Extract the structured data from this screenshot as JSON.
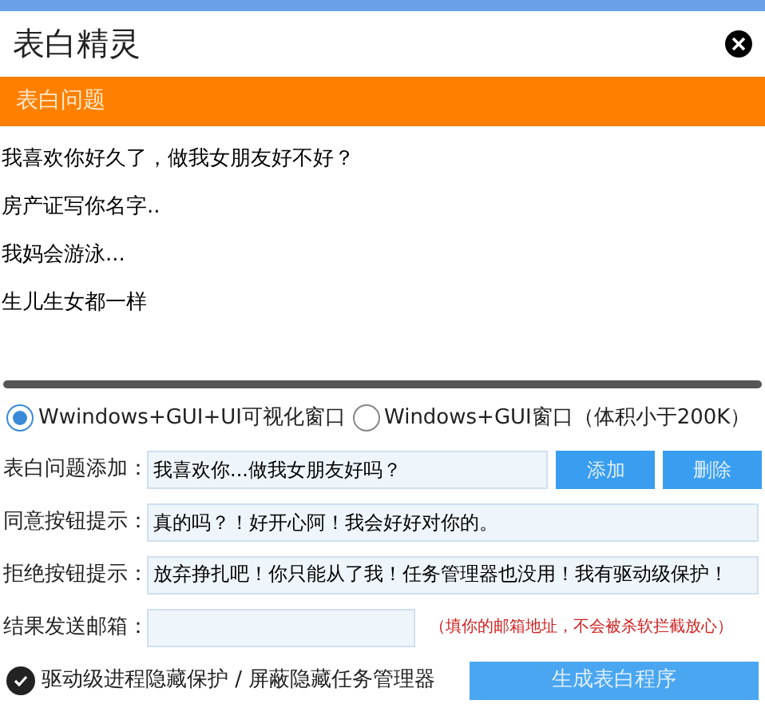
{
  "window": {
    "title": "表白精灵"
  },
  "questions": {
    "header": "表白问题",
    "items": [
      "我喜欢你好久了，做我女朋友好不好？",
      "房产证写你名字..",
      "我妈会游泳...",
      "生儿生女都一样"
    ]
  },
  "modes": [
    {
      "label": "Wwindows+GUI+UI可视化窗口",
      "selected": true
    },
    {
      "label": "Windows+GUI窗口（体积小于200K）",
      "selected": false
    }
  ],
  "fields": [
    {
      "label": "表白问题添加：",
      "value": "我喜欢你...做我女朋友好吗？",
      "buttons": [
        "添加",
        "删除"
      ]
    },
    {
      "label": "同意按钮提示：",
      "value": "真的吗？！好开心阿！我会好好对你的。"
    },
    {
      "label": "拒绝按钮提示：",
      "value": "放弃挣扎吧！你只能从了我！任务管理器也没用！我有驱动级保护！"
    },
    {
      "label": "结果发送邮箱：",
      "hint": "（填你的邮箱地址，不会被杀软拦截放心）"
    }
  ],
  "protection": {
    "label": "驱动级进程隐藏保护 / 屏蔽隐藏任务管理器",
    "checked": true
  },
  "generate_button": "生成表白程序"
}
